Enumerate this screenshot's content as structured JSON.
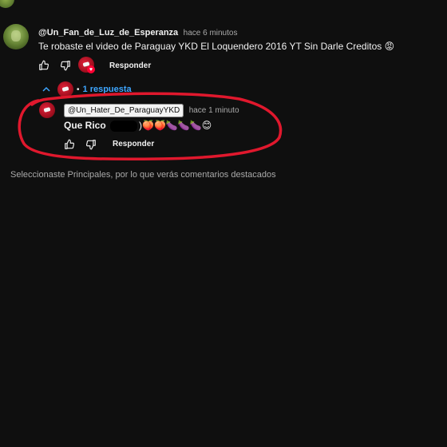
{
  "comment": {
    "username": "@Un_Fan_de_Luz_de_Esperanza",
    "time": "hace 6 minutos",
    "text": "Te robaste el video de Paraguay YKD El Loquendero 2016 YT Sin Darle Creditos 😡",
    "reply_label": "Responder",
    "replies_toggle": "1 respuesta"
  },
  "reply": {
    "mention": "@Un_Hater_De_ParaguayYKD",
    "time": "hace 1 minuto",
    "text_prefix": "Que Rico",
    "text_suffix": ")🍑🍑🍆🍆🍆😊",
    "reply_label": "Responder"
  },
  "notice": "Seleccionaste Principales, por lo que verás comentarios destacados",
  "annotation": {
    "circle_color": "#e0182d"
  },
  "icons": [
    "thumb-up-icon",
    "thumb-down-icon",
    "chevron-up-icon",
    "heart-icon"
  ]
}
